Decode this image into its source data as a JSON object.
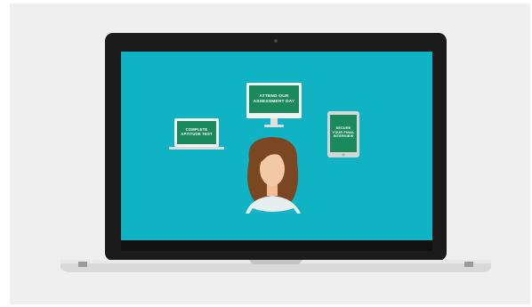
{
  "screen": {
    "cards": {
      "laptop_card": {
        "text": "COMPLETE APTITUDE TEST"
      },
      "monitor_card": {
        "text": "ATTEND OUR ASSESSMENT DAY"
      },
      "tablet_card": {
        "text": "SECURE YOUR FINAL INTERVIEW"
      }
    }
  },
  "colors": {
    "background": "#efefef",
    "screen_teal": "#0fb3c4",
    "card_green": "#1a8a5c",
    "laptop_bezel": "#1b1b1b",
    "laptop_body": "#d9d9d9",
    "hair": "#7a4722",
    "skin": "#f4c9a6"
  },
  "icons": [
    "webcam-icon",
    "laptop-device-icon",
    "monitor-device-icon",
    "tablet-device-icon",
    "woman-avatar-icon"
  ]
}
